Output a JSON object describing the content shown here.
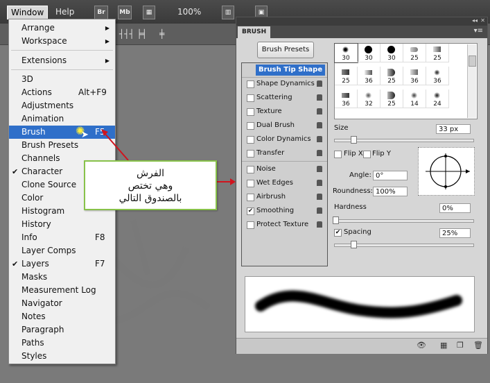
{
  "menubar": {
    "window_label": "Window",
    "help_label": "Help",
    "br": "Br",
    "mb": "Mb",
    "zoom": "100%"
  },
  "menu": {
    "items": [
      {
        "label": "Arrange",
        "arrow": "▶"
      },
      {
        "label": "Workspace",
        "arrow": "▶"
      },
      {
        "label": "Extensions",
        "arrow": "▶"
      },
      {
        "label": "3D"
      },
      {
        "label": "Actions",
        "shortcut": "Alt+F9"
      },
      {
        "label": "Adjustments"
      },
      {
        "label": "Animation"
      },
      {
        "label": "Brush",
        "shortcut": "F5"
      },
      {
        "label": "Brush Presets"
      },
      {
        "label": "Channels"
      },
      {
        "label": "Character",
        "check": "✔"
      },
      {
        "label": "Clone Source"
      },
      {
        "label": "Color"
      },
      {
        "label": "Histogram"
      },
      {
        "label": "History"
      },
      {
        "label": "Info",
        "shortcut": "F8"
      },
      {
        "label": "Layer Comps"
      },
      {
        "label": "Layers",
        "shortcut": "F7",
        "check": "✔"
      },
      {
        "label": "Masks"
      },
      {
        "label": "Measurement Log"
      },
      {
        "label": "Navigator"
      },
      {
        "label": "Notes"
      },
      {
        "label": "Paragraph"
      },
      {
        "label": "Paths"
      },
      {
        "label": "Styles"
      }
    ]
  },
  "callout": {
    "line1": "الفرش",
    "line2": "وهي تختص",
    "line3": "بالصندوق التالي"
  },
  "watermark": {
    "text": "سمير العيادي"
  },
  "panel": {
    "title": "BRUSH",
    "presets_button": "Brush Presets",
    "options": [
      {
        "label": "Brush Tip Shape"
      },
      {
        "label": "Shape Dynamics"
      },
      {
        "label": "Scattering"
      },
      {
        "label": "Texture"
      },
      {
        "label": "Dual Brush"
      },
      {
        "label": "Color Dynamics"
      },
      {
        "label": "Transfer"
      },
      {
        "label": "Noise"
      },
      {
        "label": "Wet Edges"
      },
      {
        "label": "Airbrush"
      },
      {
        "label": "Smoothing",
        "check": "✔"
      },
      {
        "label": "Protect Texture"
      }
    ],
    "tip_sizes": [
      "30",
      "30",
      "30",
      "25",
      "25",
      "25",
      "36",
      "25",
      "36",
      "36",
      "36",
      "32",
      "25",
      "14",
      "24"
    ],
    "size_label": "Size",
    "size_value": "33 px",
    "flip_x": "Flip X",
    "flip_y": "Flip Y",
    "angle_label": "Angle:",
    "angle_value": "0°",
    "roundness_label": "Roundness:",
    "roundness_value": "100%",
    "hardness_label": "Hardness",
    "hardness_value": "0%",
    "spacing_label": "Spacing",
    "spacing_value": "25%",
    "spacing_check": "✔",
    "size_level": 0.12,
    "spacing_level": 0.12
  }
}
